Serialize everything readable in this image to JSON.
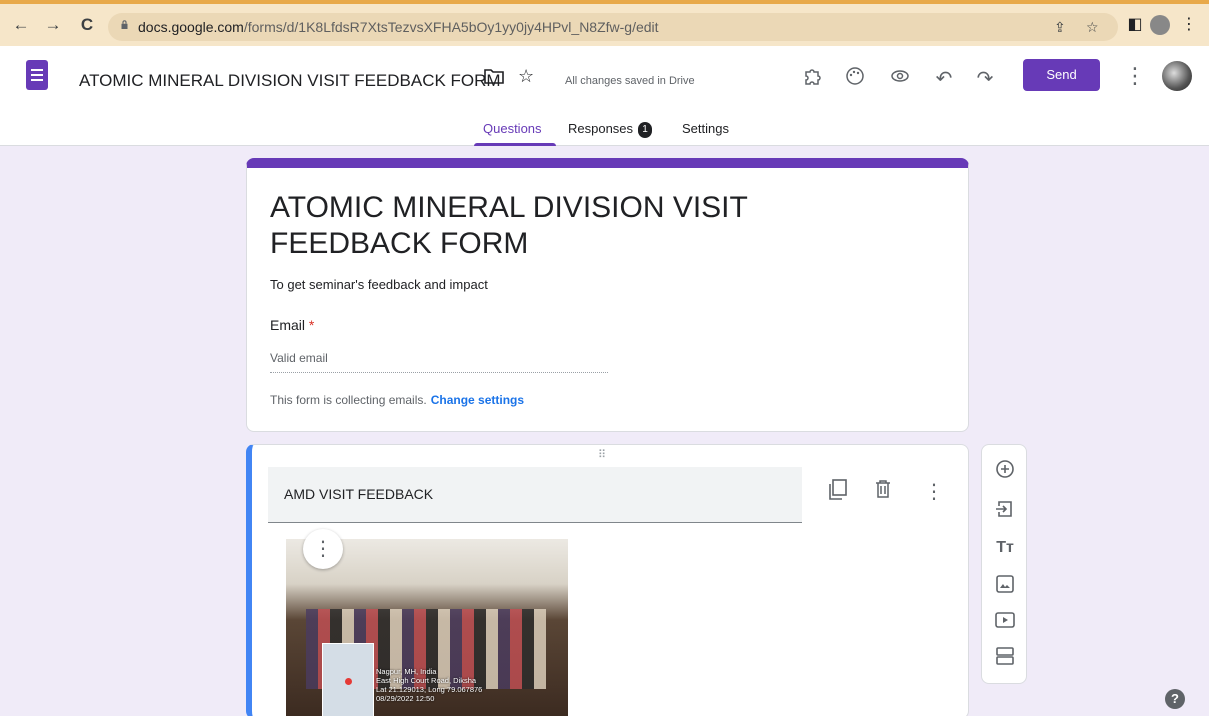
{
  "browser": {
    "url_host": "docs.google.com",
    "url_path": "/forms/d/1K8LfdsR7XtsTezvsXFHA5bOy1yy0jy4HPvl_N8Zfw-g/edit"
  },
  "header": {
    "title": "ATOMIC MINERAL DIVISION  VISIT FEEDBACK FORM",
    "save_status": "All changes saved in Drive",
    "send_label": "Send"
  },
  "tabs": [
    {
      "label": "Questions",
      "active": true
    },
    {
      "label": "Responses",
      "badge": "1"
    },
    {
      "label": "Settings"
    }
  ],
  "form": {
    "title": "ATOMIC MINERAL DIVISION  VISIT FEEDBACK FORM",
    "description": "To get seminar's feedback and impact",
    "email_label": "Email",
    "email_required_mark": "*",
    "email_placeholder": "Valid email",
    "collect_notice": "This form is collecting emails.",
    "change_settings": "Change settings"
  },
  "section": {
    "title": "AMD VISIT FEEDBACK",
    "photo_caption": [
      "Nagpur, MH, India",
      "East High Court Road, Diksha",
      "Lat 21.129013, Long 79.067876",
      "08/29/2022 12:50"
    ]
  },
  "help_label": "?"
}
